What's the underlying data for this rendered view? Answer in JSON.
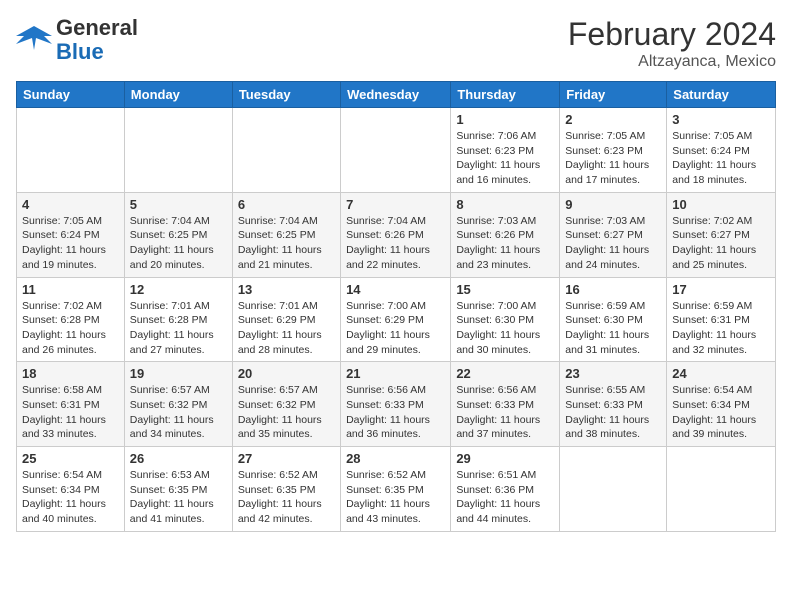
{
  "header": {
    "logo_general": "General",
    "logo_blue": "Blue",
    "month_year": "February 2024",
    "location": "Altzayanca, Mexico"
  },
  "weekdays": [
    "Sunday",
    "Monday",
    "Tuesday",
    "Wednesday",
    "Thursday",
    "Friday",
    "Saturday"
  ],
  "weeks": [
    [
      {
        "day": "",
        "info": ""
      },
      {
        "day": "",
        "info": ""
      },
      {
        "day": "",
        "info": ""
      },
      {
        "day": "",
        "info": ""
      },
      {
        "day": "1",
        "info": "Sunrise: 7:06 AM\nSunset: 6:23 PM\nDaylight: 11 hours and 16 minutes."
      },
      {
        "day": "2",
        "info": "Sunrise: 7:05 AM\nSunset: 6:23 PM\nDaylight: 11 hours and 17 minutes."
      },
      {
        "day": "3",
        "info": "Sunrise: 7:05 AM\nSunset: 6:24 PM\nDaylight: 11 hours and 18 minutes."
      }
    ],
    [
      {
        "day": "4",
        "info": "Sunrise: 7:05 AM\nSunset: 6:24 PM\nDaylight: 11 hours and 19 minutes."
      },
      {
        "day": "5",
        "info": "Sunrise: 7:04 AM\nSunset: 6:25 PM\nDaylight: 11 hours and 20 minutes."
      },
      {
        "day": "6",
        "info": "Sunrise: 7:04 AM\nSunset: 6:25 PM\nDaylight: 11 hours and 21 minutes."
      },
      {
        "day": "7",
        "info": "Sunrise: 7:04 AM\nSunset: 6:26 PM\nDaylight: 11 hours and 22 minutes."
      },
      {
        "day": "8",
        "info": "Sunrise: 7:03 AM\nSunset: 6:26 PM\nDaylight: 11 hours and 23 minutes."
      },
      {
        "day": "9",
        "info": "Sunrise: 7:03 AM\nSunset: 6:27 PM\nDaylight: 11 hours and 24 minutes."
      },
      {
        "day": "10",
        "info": "Sunrise: 7:02 AM\nSunset: 6:27 PM\nDaylight: 11 hours and 25 minutes."
      }
    ],
    [
      {
        "day": "11",
        "info": "Sunrise: 7:02 AM\nSunset: 6:28 PM\nDaylight: 11 hours and 26 minutes."
      },
      {
        "day": "12",
        "info": "Sunrise: 7:01 AM\nSunset: 6:28 PM\nDaylight: 11 hours and 27 minutes."
      },
      {
        "day": "13",
        "info": "Sunrise: 7:01 AM\nSunset: 6:29 PM\nDaylight: 11 hours and 28 minutes."
      },
      {
        "day": "14",
        "info": "Sunrise: 7:00 AM\nSunset: 6:29 PM\nDaylight: 11 hours and 29 minutes."
      },
      {
        "day": "15",
        "info": "Sunrise: 7:00 AM\nSunset: 6:30 PM\nDaylight: 11 hours and 30 minutes."
      },
      {
        "day": "16",
        "info": "Sunrise: 6:59 AM\nSunset: 6:30 PM\nDaylight: 11 hours and 31 minutes."
      },
      {
        "day": "17",
        "info": "Sunrise: 6:59 AM\nSunset: 6:31 PM\nDaylight: 11 hours and 32 minutes."
      }
    ],
    [
      {
        "day": "18",
        "info": "Sunrise: 6:58 AM\nSunset: 6:31 PM\nDaylight: 11 hours and 33 minutes."
      },
      {
        "day": "19",
        "info": "Sunrise: 6:57 AM\nSunset: 6:32 PM\nDaylight: 11 hours and 34 minutes."
      },
      {
        "day": "20",
        "info": "Sunrise: 6:57 AM\nSunset: 6:32 PM\nDaylight: 11 hours and 35 minutes."
      },
      {
        "day": "21",
        "info": "Sunrise: 6:56 AM\nSunset: 6:33 PM\nDaylight: 11 hours and 36 minutes."
      },
      {
        "day": "22",
        "info": "Sunrise: 6:56 AM\nSunset: 6:33 PM\nDaylight: 11 hours and 37 minutes."
      },
      {
        "day": "23",
        "info": "Sunrise: 6:55 AM\nSunset: 6:33 PM\nDaylight: 11 hours and 38 minutes."
      },
      {
        "day": "24",
        "info": "Sunrise: 6:54 AM\nSunset: 6:34 PM\nDaylight: 11 hours and 39 minutes."
      }
    ],
    [
      {
        "day": "25",
        "info": "Sunrise: 6:54 AM\nSunset: 6:34 PM\nDaylight: 11 hours and 40 minutes."
      },
      {
        "day": "26",
        "info": "Sunrise: 6:53 AM\nSunset: 6:35 PM\nDaylight: 11 hours and 41 minutes."
      },
      {
        "day": "27",
        "info": "Sunrise: 6:52 AM\nSunset: 6:35 PM\nDaylight: 11 hours and 42 minutes."
      },
      {
        "day": "28",
        "info": "Sunrise: 6:52 AM\nSunset: 6:35 PM\nDaylight: 11 hours and 43 minutes."
      },
      {
        "day": "29",
        "info": "Sunrise: 6:51 AM\nSunset: 6:36 PM\nDaylight: 11 hours and 44 minutes."
      },
      {
        "day": "",
        "info": ""
      },
      {
        "day": "",
        "info": ""
      }
    ]
  ]
}
